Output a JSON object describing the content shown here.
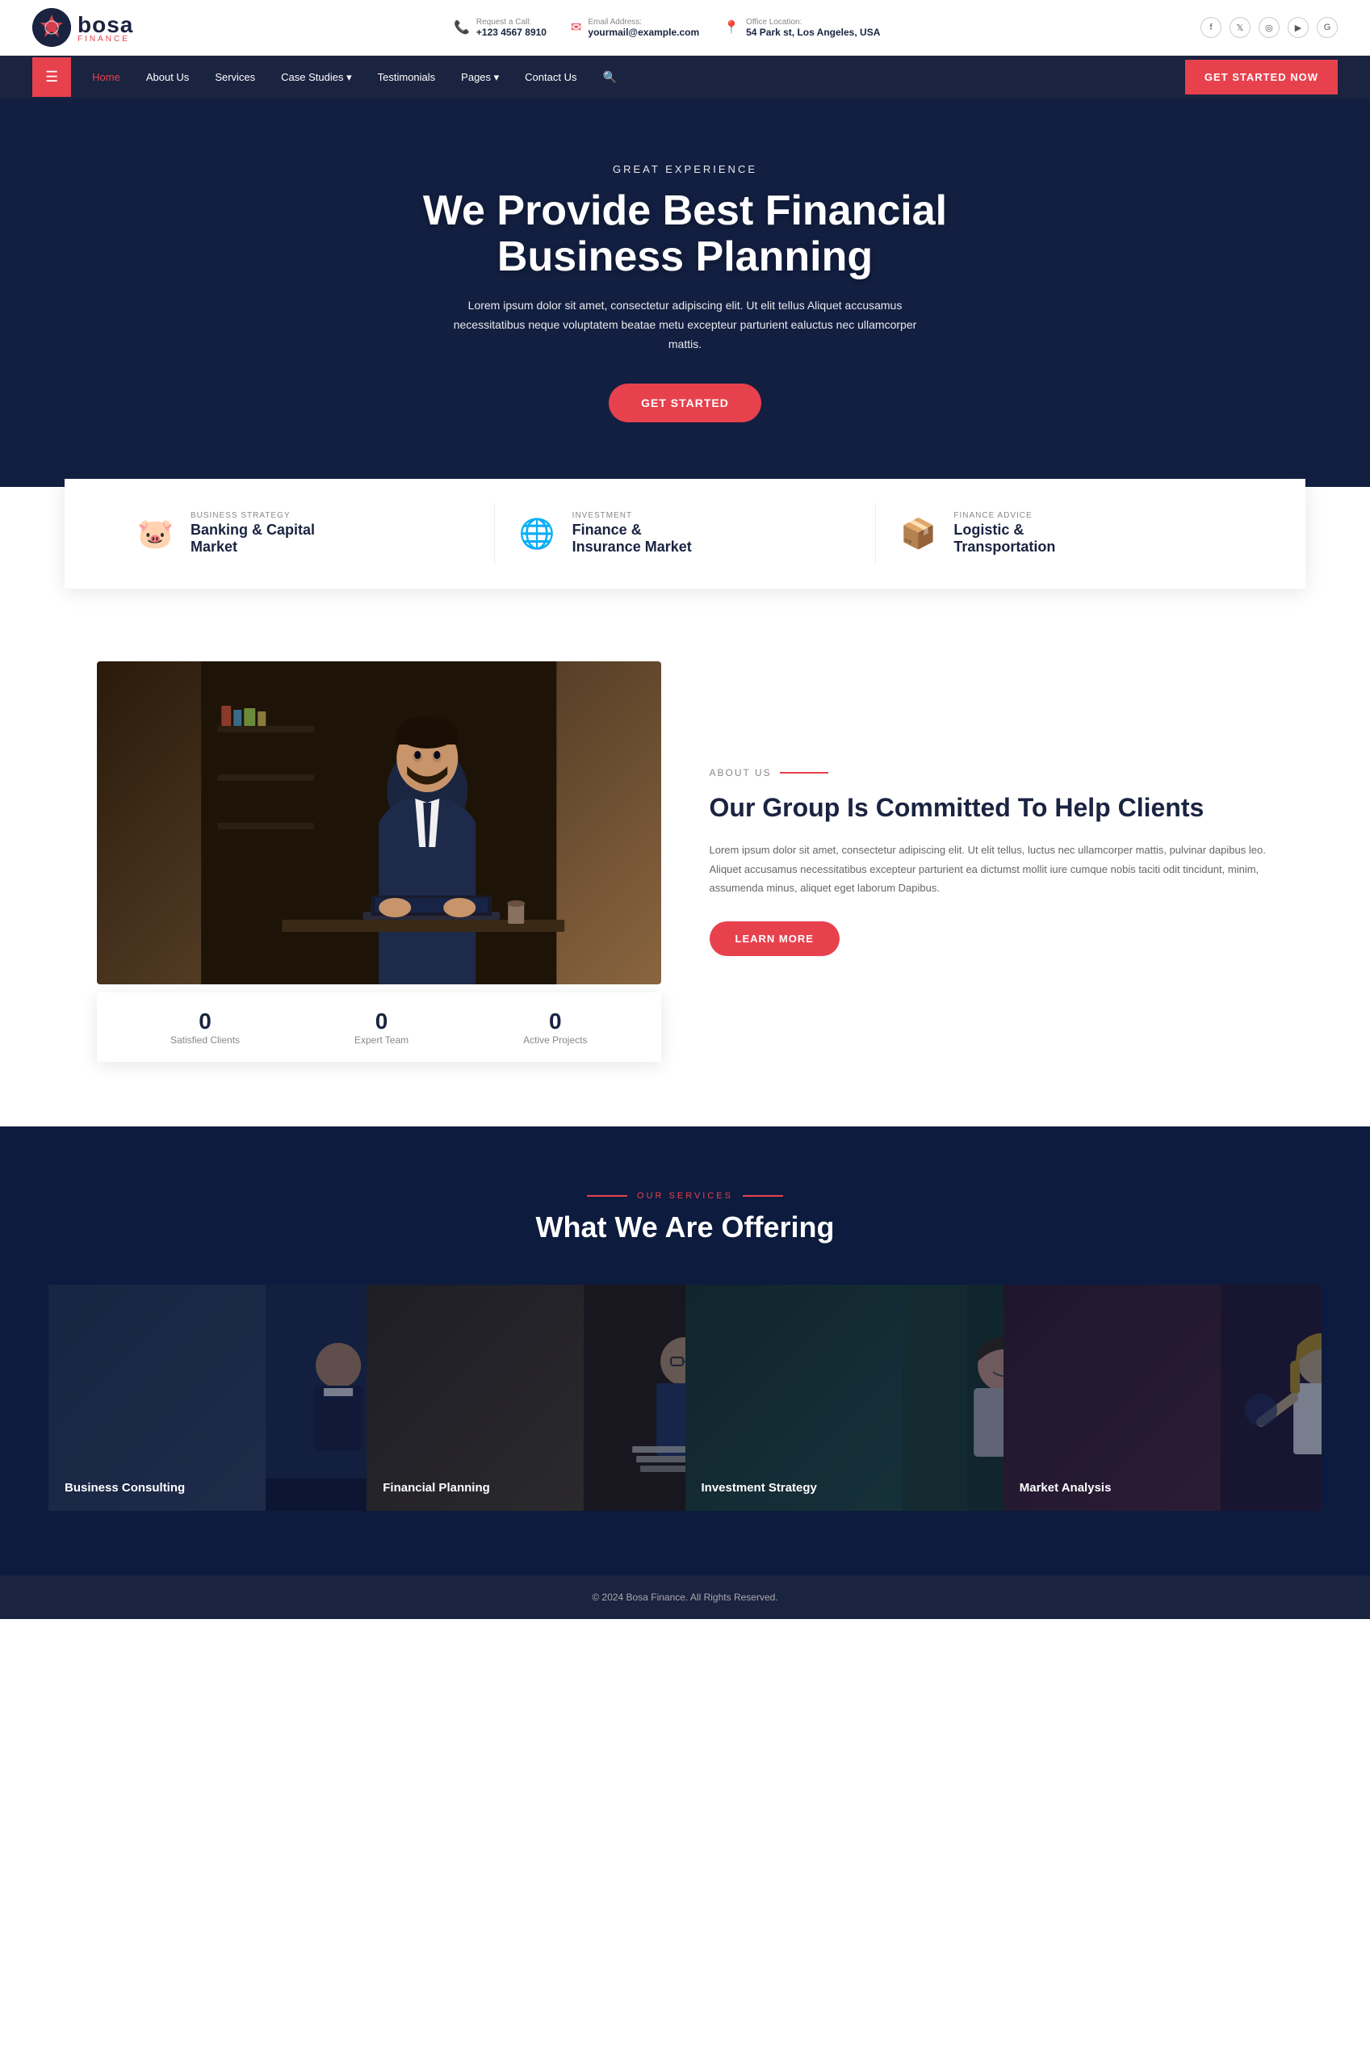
{
  "topbar": {
    "logo_name": "bosa",
    "logo_sub": "FINANCE",
    "request_label": "Request a Call:",
    "phone": "+123 4567 8910",
    "email_label": "Email Address:",
    "email": "yourmail@example.com",
    "office_label": "Office Location:",
    "office": "54 Park st, Los Angeles, USA"
  },
  "social": {
    "icons": [
      "f",
      "t",
      "i",
      "y",
      "g"
    ]
  },
  "nav": {
    "hamburger": "☰",
    "links": [
      {
        "label": "Home",
        "active": true
      },
      {
        "label": "About Us"
      },
      {
        "label": "Services"
      },
      {
        "label": "Case Studies",
        "dropdown": true
      },
      {
        "label": "Testimonials"
      },
      {
        "label": "Pages",
        "dropdown": true
      },
      {
        "label": "Contact Us"
      }
    ],
    "cta": "GET STARTED NOW"
  },
  "hero": {
    "eyebrow": "GREAT EXPERIENCE",
    "title": "We Provide Best Financial Business Planning",
    "desc": "Lorem ipsum dolor sit amet, consectetur adipiscing elit. Ut elit tellus Aliquet accusamus necessitatibus neque voluptatem beatae metu excepteur parturient ealuctus nec ullamcorper mattis.",
    "cta": "GET STARTED"
  },
  "features": [
    {
      "icon": "piggy",
      "label": "BUSINESS STRATEGY",
      "title": "Banking & Capital Market"
    },
    {
      "icon": "globe",
      "label": "INVESTMENT",
      "title": "Finance & Insurance Market"
    },
    {
      "icon": "chart",
      "label": "FINANCE ADVICE",
      "title": "Logistic & Transportation"
    }
  ],
  "about": {
    "eyebrow": "ABOUT US",
    "title": "Our Group Is Committed To Help Clients",
    "desc": "Lorem ipsum dolor sit amet, consectetur adipiscing elit. Ut elit tellus, luctus nec ullamcorper mattis, pulvinar dapibus leo. Aliquet accusamus necessitatibus excepteur parturient ea dictumst mollit iure cumque nobis taciti odit tincidunt, minim, assumenda minus, aliquet eget laborum Dapibus.",
    "cta": "LEARN MORE",
    "stats": [
      {
        "num": "0",
        "label": "Satisfied Clients"
      },
      {
        "num": "0",
        "label": "Expert Team"
      },
      {
        "num": "0",
        "label": "Active Projects"
      }
    ]
  },
  "services": {
    "eyebrow": "OUR SERVICES",
    "title": "What We Are Offering",
    "cards": [
      {
        "title": "Business Consulting",
        "color": "#2a3a5a"
      },
      {
        "title": "Financial Planning",
        "color": "#3a2a1a"
      },
      {
        "title": "Investment Strategy",
        "color": "#1a3a2a"
      },
      {
        "title": "Market Analysis",
        "color": "#3a1a2a"
      }
    ]
  },
  "footer": {
    "text": "© 2024 Bosa Finance. All Rights Reserved."
  }
}
